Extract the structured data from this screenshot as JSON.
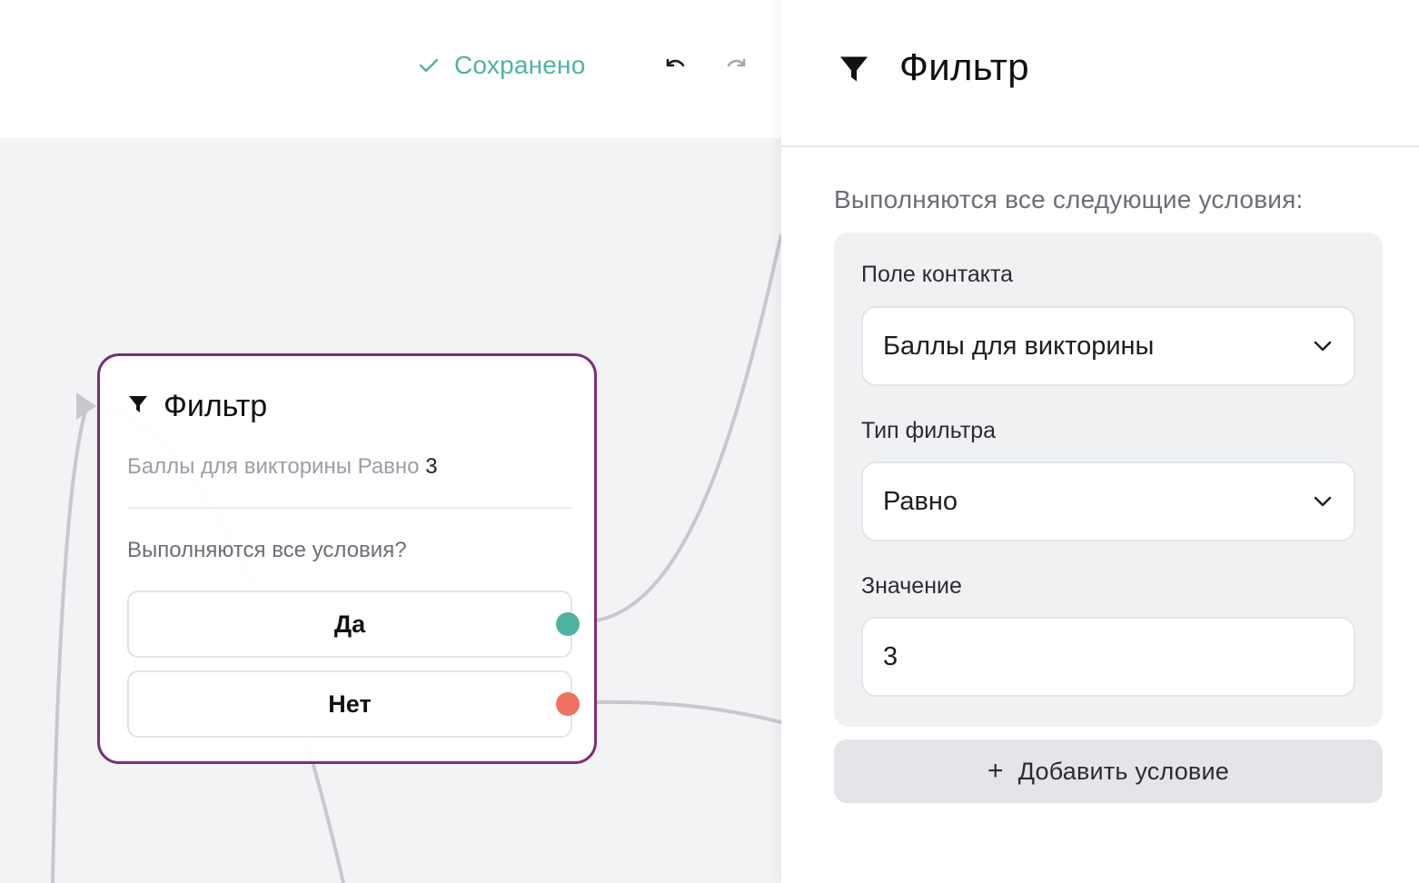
{
  "topbar": {
    "saved_label": "Сохранено"
  },
  "node": {
    "title": "Фильтр",
    "summary_text": "Баллы для викторины Равно",
    "summary_value": "3",
    "question": "Выполняются все условия?",
    "yes_label": "Да",
    "no_label": "Нет"
  },
  "panel": {
    "title": "Фильтр",
    "subtitle": "Выполняются все следующие условия:",
    "contact_field_label": "Поле контакта",
    "contact_field_value": "Баллы для викторины",
    "filter_type_label": "Тип фильтра",
    "filter_type_value": "Равно",
    "value_label": "Значение",
    "value_value": "3",
    "add_condition_label": "Добавить условие",
    "add_condition_icon": "+"
  },
  "icons": [
    "check-icon",
    "undo-icon",
    "redo-icon",
    "funnel-icon",
    "chevron-down-icon",
    "plus-icon"
  ],
  "colors": {
    "accent_saved": "#4fb3a4",
    "node_border": "#7b2f78",
    "port_yes": "#4fb3a4",
    "port_no": "#ef7260",
    "canvas_bg": "#f2f3f5"
  }
}
